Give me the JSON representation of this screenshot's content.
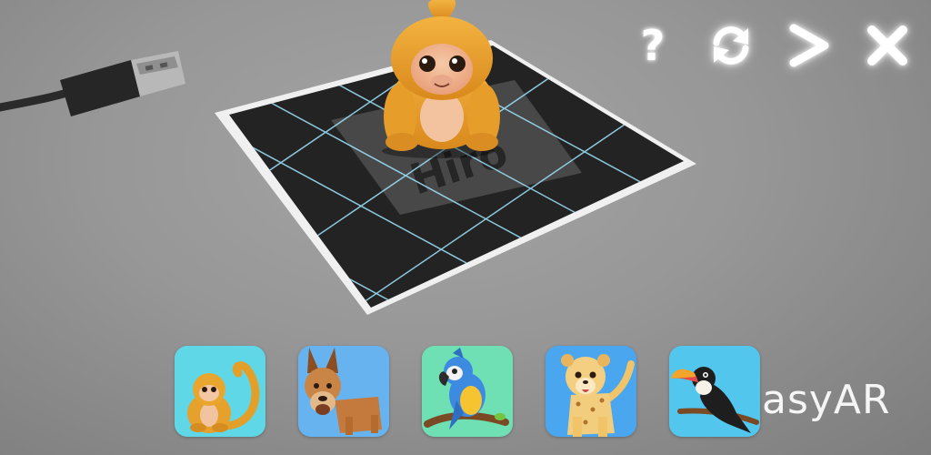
{
  "scene": {
    "marker_text": "Hiro",
    "selected_animal": "monkey",
    "icons": [
      "usb-cable",
      "marker-card",
      "monkey-3d-model"
    ]
  },
  "controls": {
    "help_label": "?",
    "icons": [
      "help-icon",
      "refresh-icon",
      "next-icon",
      "close-icon"
    ]
  },
  "animals": [
    {
      "name": "monkey",
      "bg": "#5fd7e6"
    },
    {
      "name": "dog",
      "bg": "#67b3ef"
    },
    {
      "name": "parrot",
      "bg": "#6fe0b4"
    },
    {
      "name": "cheetah",
      "bg": "#4aa6ee"
    },
    {
      "name": "toucan",
      "bg": "#53c6ee"
    }
  ],
  "watermark": "asyAR"
}
